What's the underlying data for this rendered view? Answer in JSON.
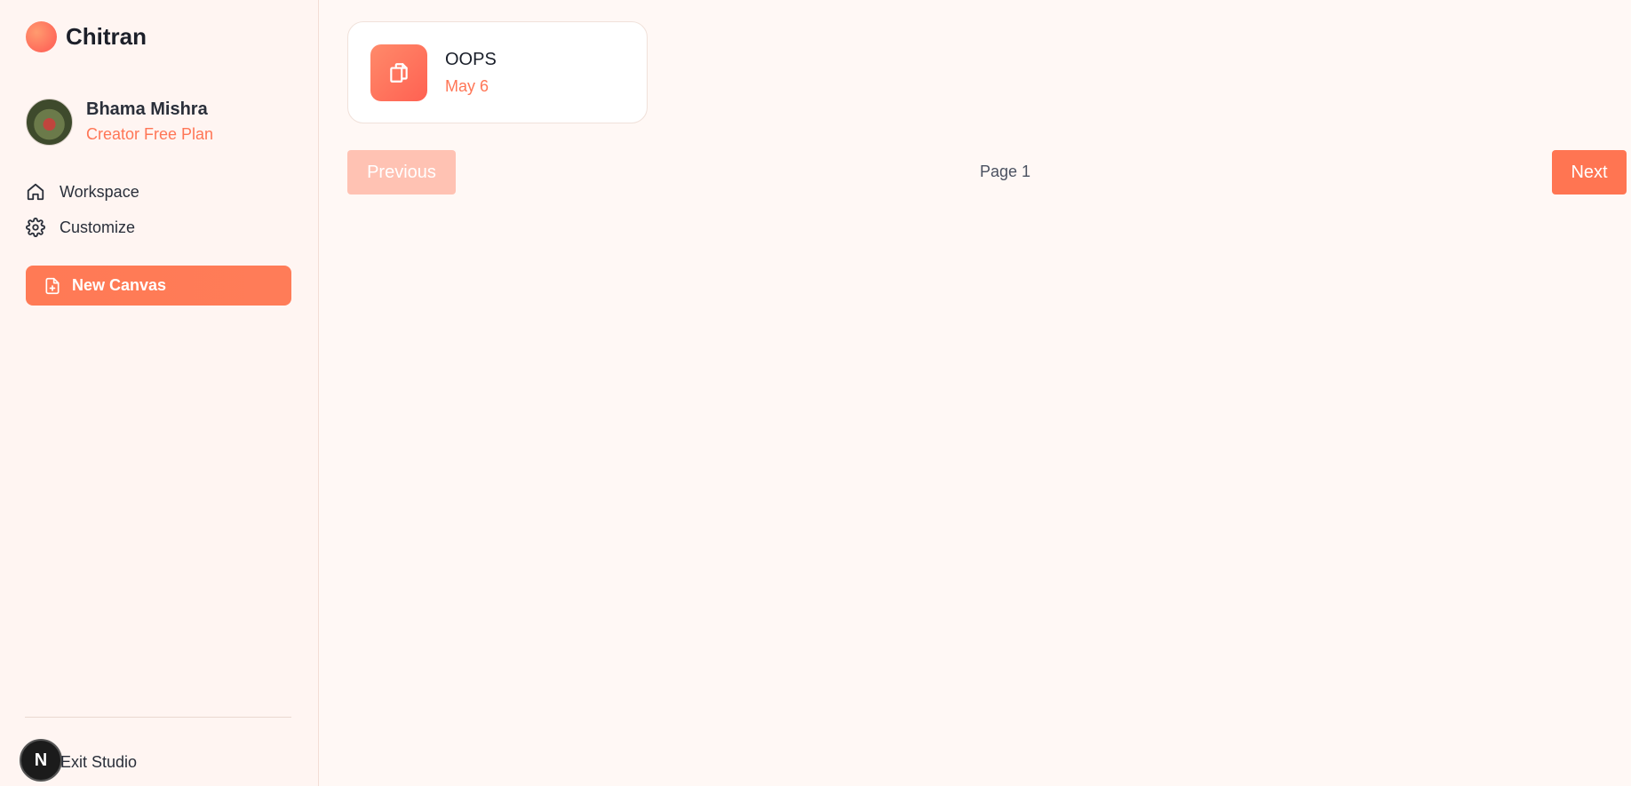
{
  "brand": {
    "name": "Chitran",
    "accent": "#ff7656"
  },
  "profile": {
    "name": "Bhama Mishra",
    "plan": "Creator Free Plan"
  },
  "nav": {
    "items": [
      {
        "label": "Workspace",
        "icon": "home-icon"
      },
      {
        "label": "Customize",
        "icon": "gear-icon"
      }
    ]
  },
  "actions": {
    "new_canvas_label": "New Canvas",
    "new_canvas_icon": "file-plus-icon"
  },
  "footer": {
    "badge_letter": "N",
    "exit_label": "Exit Studio"
  },
  "canvases": [
    {
      "title": "OOPS",
      "date": "May 6",
      "icon": "copy-icon"
    }
  ],
  "pagination": {
    "previous_label": "Previous",
    "next_label": "Next",
    "page_label": "Page 1"
  }
}
